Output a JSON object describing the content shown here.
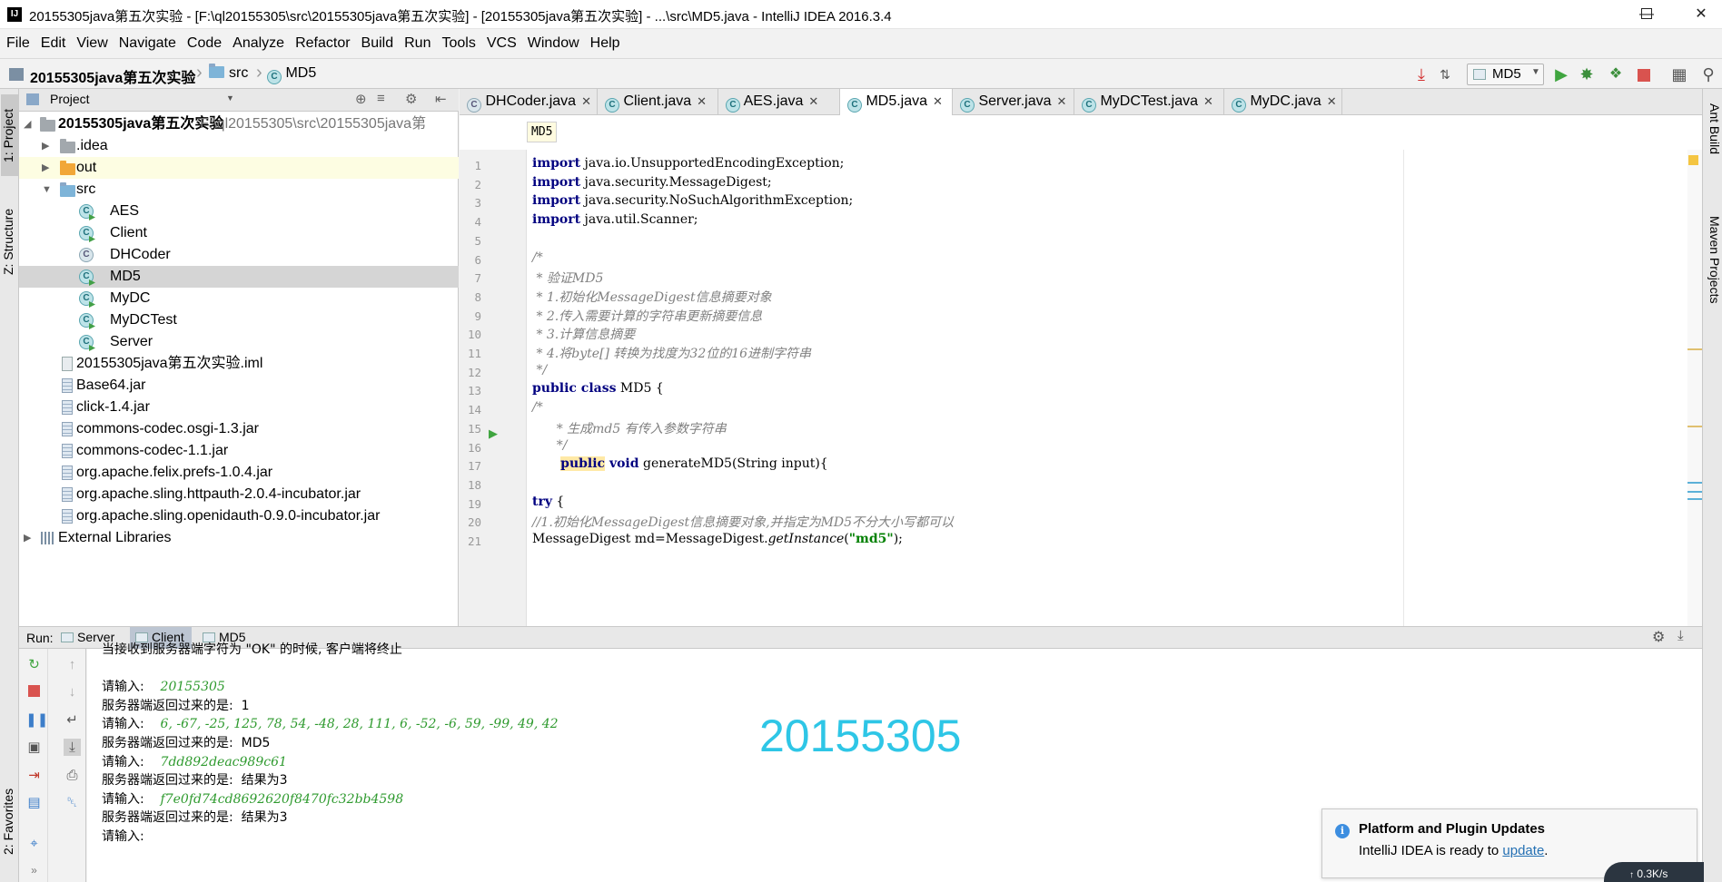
{
  "window": {
    "title": "20155305java第五次实验 - [F:\\ql20155305\\src\\20155305java第五次实验] - [20155305java第五次实验] - ...\\src\\MD5.java - IntelliJ IDEA 2016.3.4",
    "icon": "intellij-icon"
  },
  "menu": [
    "File",
    "Edit",
    "View",
    "Navigate",
    "Code",
    "Analyze",
    "Refactor",
    "Build",
    "Run",
    "Tools",
    "VCS",
    "Window",
    "Help"
  ],
  "nav": {
    "crumbs": [
      "20155305java第五次实验",
      "src",
      "MD5"
    ],
    "run_config": "MD5"
  },
  "left_strip": {
    "project": "1: Project",
    "structure": "Z: Structure",
    "favorites": "2: Favorites"
  },
  "right_strip": {
    "ant": "Ant Build",
    "maven": "Maven Projects"
  },
  "project": {
    "header": "Project",
    "tree": [
      {
        "label": "20155305java第五次实验",
        "extra": "F:\\ql20155305\\src\\20155305java第",
        "type": "module"
      },
      {
        "label": ".idea",
        "type": "folder"
      },
      {
        "label": "out",
        "type": "folder-orange"
      },
      {
        "label": "src",
        "type": "folder-blue"
      },
      {
        "label": "AES",
        "type": "class-run"
      },
      {
        "label": "Client",
        "type": "class-run"
      },
      {
        "label": "DHCoder",
        "type": "class"
      },
      {
        "label": "MD5",
        "type": "class-run"
      },
      {
        "label": "MyDC",
        "type": "class-run"
      },
      {
        "label": "MyDCTest",
        "type": "class-run"
      },
      {
        "label": "Server",
        "type": "class-run"
      },
      {
        "label": "20155305java第五次实验.iml",
        "type": "file"
      },
      {
        "label": "Base64.jar",
        "type": "jar"
      },
      {
        "label": "click-1.4.jar",
        "type": "jar"
      },
      {
        "label": "commons-codec.osgi-1.3.jar",
        "type": "jar"
      },
      {
        "label": "commons-codec-1.1.jar",
        "type": "jar"
      },
      {
        "label": "org.apache.felix.prefs-1.0.4.jar",
        "type": "jar"
      },
      {
        "label": "org.apache.sling.httpauth-2.0.4-incubator.jar",
        "type": "jar"
      },
      {
        "label": "org.apache.sling.openidauth-0.9.0-incubator.jar",
        "type": "jar"
      },
      {
        "label": "External Libraries",
        "type": "lib"
      }
    ]
  },
  "tabs": [
    "DHCoder.java",
    "Client.java",
    "AES.java",
    "MD5.java",
    "Server.java",
    "MyDCTest.java",
    "MyDC.java"
  ],
  "active_tab": "MD5.java",
  "editor": {
    "breadcrumb": "MD5",
    "lines": [
      {
        "n": "1",
        "kw": "import",
        "rest": " java.io.UnsupportedEncodingException;"
      },
      {
        "n": "2",
        "kw": "import",
        "rest": " java.security.MessageDigest;"
      },
      {
        "n": "3",
        "kw": "import",
        "rest": " java.security.NoSuchAlgorithmException;"
      },
      {
        "n": "4",
        "kw": "import",
        "rest": " java.util.Scanner;"
      },
      {
        "n": "5",
        "text": ""
      },
      {
        "n": "6",
        "comment": "/*"
      },
      {
        "n": "7",
        "comment": " * 验证MD5"
      },
      {
        "n": "8",
        "comment": " * 1.初始化MessageDigest信息摘要对象"
      },
      {
        "n": "9",
        "comment": " * 2.传入需要计算的字符串更新摘要信息"
      },
      {
        "n": "10",
        "comment": " * 3.计算信息摘要"
      },
      {
        "n": "11",
        "comment": " * 4.将byte[] 转换为找度为32位的16进制字符串"
      },
      {
        "n": "12",
        "comment": " */"
      },
      {
        "n": "13",
        "kw": "public class",
        "rest": " MD5 {"
      },
      {
        "n": "14",
        "comment": "/*"
      },
      {
        "n": "15",
        "comment": "      * 生成md5 有传入参数字符串"
      },
      {
        "n": "16",
        "comment": "      */"
      },
      {
        "n": "17",
        "pre": "       ",
        "kw": "public",
        "kw2": " void",
        "rest": " generateMD5(String input){"
      },
      {
        "n": "18",
        "text": ""
      },
      {
        "n": "19",
        "kw": "try",
        "rest": " {"
      },
      {
        "n": "20",
        "comment": "//1.初始化MessageDigest信息摘要对象,并指定为MD5不分大小写都可以"
      },
      {
        "n": "21",
        "text": "MessageDigest md=MessageDigest.",
        "ital": "getInstance",
        "after": "(",
        "str": "\"md5\"",
        "end": ");"
      }
    ]
  },
  "run": {
    "label": "Run:",
    "tabs": [
      "Server",
      "Client",
      "MD5"
    ],
    "active": "Client",
    "console": [
      {
        "text": "当接收到服务器端字符为 \"OK\" 的时候, 客户端将终止"
      },
      {
        "text": ""
      },
      {
        "text": "请输入:    ",
        "input": "20155305"
      },
      {
        "text": "服务器端返回过来的是:  1"
      },
      {
        "text": "请输入:    ",
        "input": "6, -67, -25, 125, 78, 54, -48, 28, 111, 6, -52, -6, 59, -99, 49, 42"
      },
      {
        "text": "服务器端返回过来的是:  MD5"
      },
      {
        "text": "请输入:    ",
        "input": "7dd892deac989c61"
      },
      {
        "text": "服务器端返回过来的是:  结果为3"
      },
      {
        "text": "请输入:    ",
        "input": "f7e0fd74cd8692620f8470fc32bb4598"
      },
      {
        "text": "服务器端返回过来的是:  结果为3"
      },
      {
        "text": "请输入:"
      }
    ],
    "watermark": "20155305"
  },
  "notification": {
    "title": "Platform and Plugin Updates",
    "text": "IntelliJ IDEA is ready to ",
    "link": "update",
    "after": "."
  },
  "netspeed": "0.3K/s",
  "colors": {
    "accent": "#2ec6e6",
    "keyword": "#000080",
    "string": "#008000",
    "comment": "#808080",
    "selection": "#d5d5d5"
  }
}
